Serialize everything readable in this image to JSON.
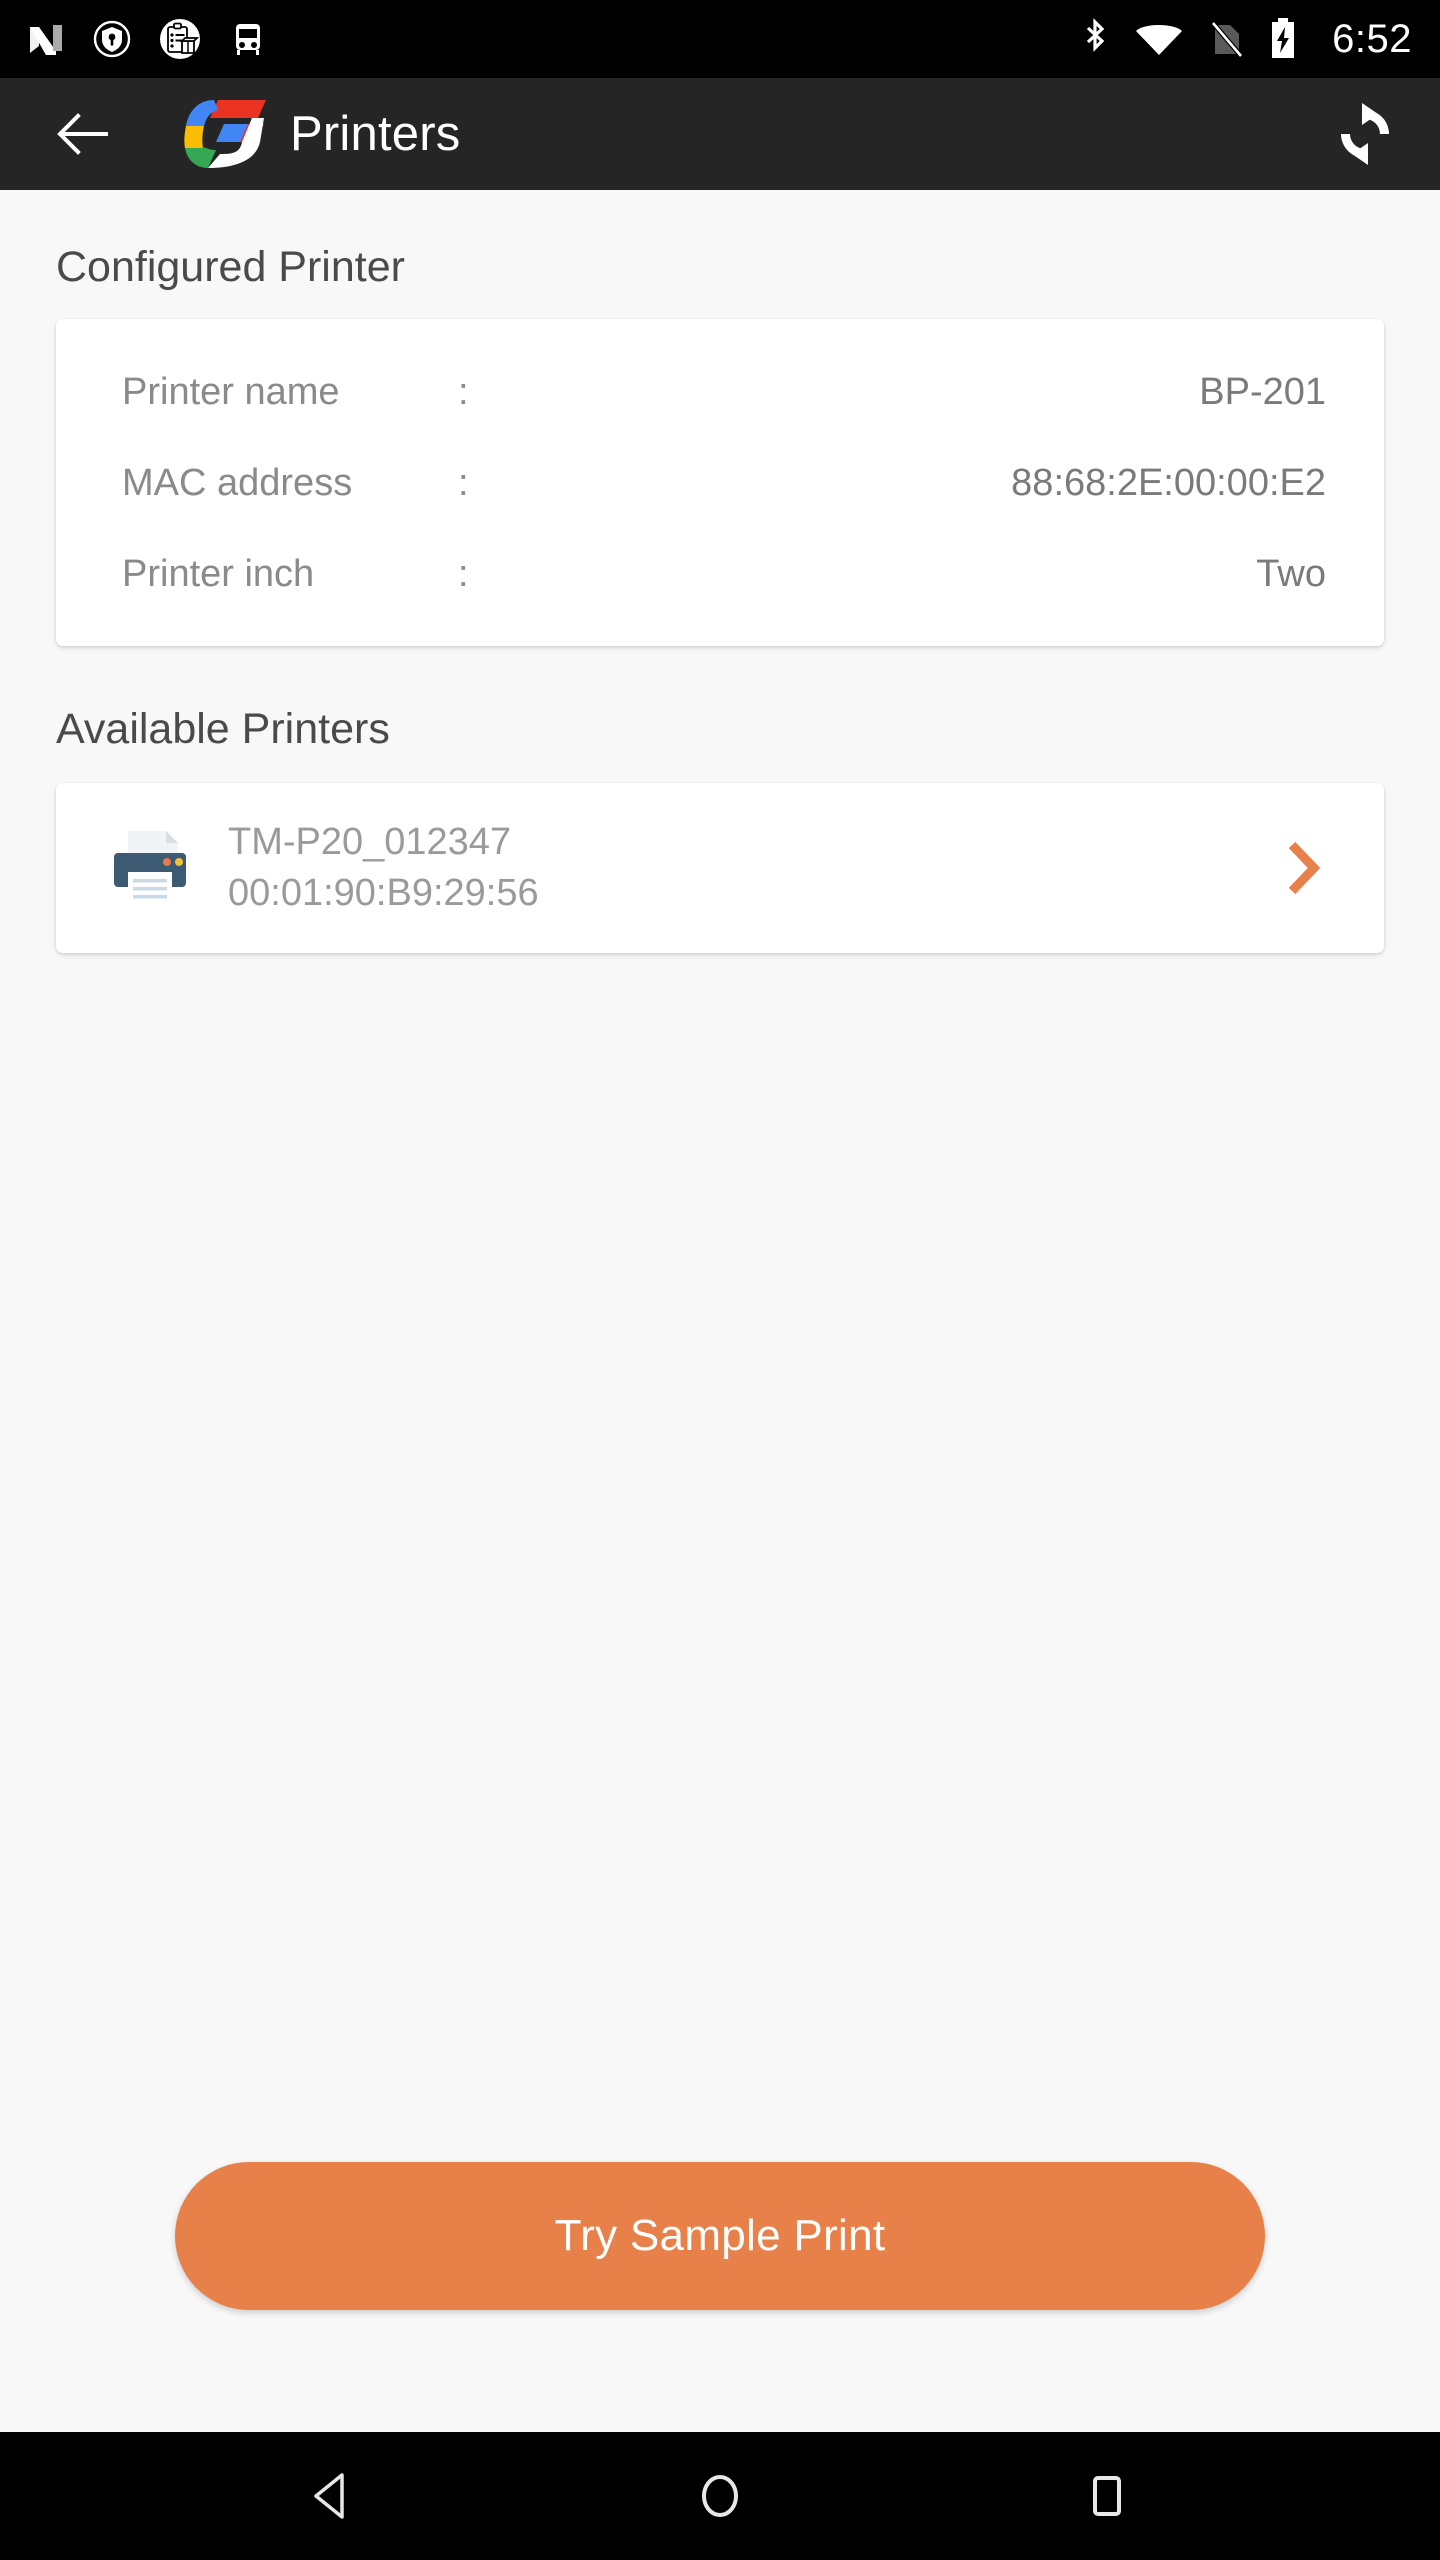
{
  "status_bar": {
    "time": "6:52",
    "notification_icons": [
      "android-n-icon",
      "shield-key-icon",
      "clipboard-box-icon",
      "bus-icon"
    ],
    "system_icons": [
      "bluetooth-icon",
      "wifi-icon",
      "no-sim-icon",
      "battery-charging-icon"
    ]
  },
  "app_bar": {
    "back_icon": "back-arrow-icon",
    "logo_icon": "app-logo-icon",
    "title": "Printers",
    "refresh_icon": "refresh-icon"
  },
  "configured": {
    "section_title": "Configured Printer",
    "separator": ":",
    "rows": [
      {
        "label": "Printer name",
        "value": "BP-201"
      },
      {
        "label": "MAC address",
        "value": "88:68:2E:00:00:E2"
      },
      {
        "label": "Printer inch",
        "value": "Two"
      }
    ]
  },
  "available": {
    "section_title": "Available Printers",
    "printers": [
      {
        "name": "TM-P20_012347",
        "mac": "00:01:90:B9:29:56",
        "icon": "printer-icon",
        "chevron": "chevron-right-icon"
      }
    ]
  },
  "actions": {
    "sample_print_label": "Try Sample Print"
  },
  "nav_bar": {
    "back": "nav-back-icon",
    "home": "nav-home-icon",
    "recents": "nav-recents-icon"
  },
  "colors": {
    "accent_orange": "#E8804A",
    "appbar_bg": "#252525",
    "page_bg": "#F8F8F8",
    "card_bg": "#FFFFFF",
    "heading_text": "#4A4A4A",
    "body_text": "#8A8A8A",
    "printer_icon_body": "#3D5A73"
  }
}
